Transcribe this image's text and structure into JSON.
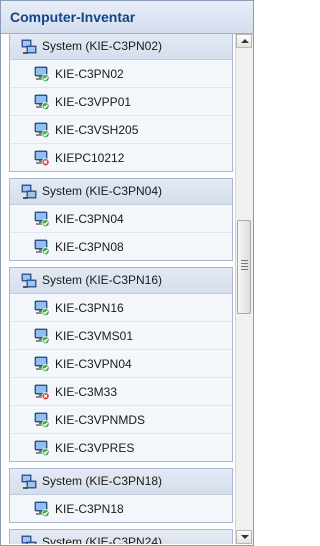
{
  "header": {
    "title": "Computer-Inventar"
  },
  "groups": [
    {
      "label": "System (KIE-C3PN02)",
      "items": [
        {
          "label": "KIE-C3PN02",
          "status": "ok"
        },
        {
          "label": "KIE-C3VPP01",
          "status": "ok"
        },
        {
          "label": "KIE-C3VSH205",
          "status": "ok"
        },
        {
          "label": "KIEPC10212",
          "status": "error"
        }
      ]
    },
    {
      "label": "System (KIE-C3PN04)",
      "items": [
        {
          "label": "KIE-C3PN04",
          "status": "ok"
        },
        {
          "label": "KIE-C3PN08",
          "status": "ok"
        }
      ]
    },
    {
      "label": "System (KIE-C3PN16)",
      "items": [
        {
          "label": "KIE-C3PN16",
          "status": "ok"
        },
        {
          "label": "KIE-C3VMS01",
          "status": "ok"
        },
        {
          "label": "KIE-C3VPN04",
          "status": "ok"
        },
        {
          "label": "KIE-C3M33",
          "status": "error"
        },
        {
          "label": "KIE-C3VPNMDS",
          "status": "ok"
        },
        {
          "label": "KIE-C3VPRES",
          "status": "ok"
        }
      ]
    },
    {
      "label": "System (KIE-C3PN18)",
      "items": [
        {
          "label": "KIE-C3PN18",
          "status": "ok"
        }
      ]
    },
    {
      "label": "System (KIE-C3PN24)",
      "items": []
    }
  ],
  "colors": {
    "title_text": "#15428b",
    "status_ok": "#3cae3c",
    "status_error": "#d83a3a"
  },
  "icons": {
    "group": "network-systems-icon",
    "item": "computer-monitor-icon",
    "ok_badge": "check-icon",
    "error_badge": "x-icon"
  }
}
